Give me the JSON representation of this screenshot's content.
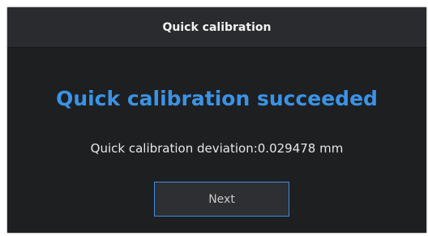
{
  "dialog": {
    "title": "Quick calibration",
    "headline": "Quick calibration succeeded",
    "deviation_text": "Quick calibration deviation:0.029478 mm",
    "next_label": "Next"
  },
  "colors": {
    "accent": "#3a93e6",
    "background": "#1e1f21",
    "titlebar": "#2a2b2e"
  }
}
